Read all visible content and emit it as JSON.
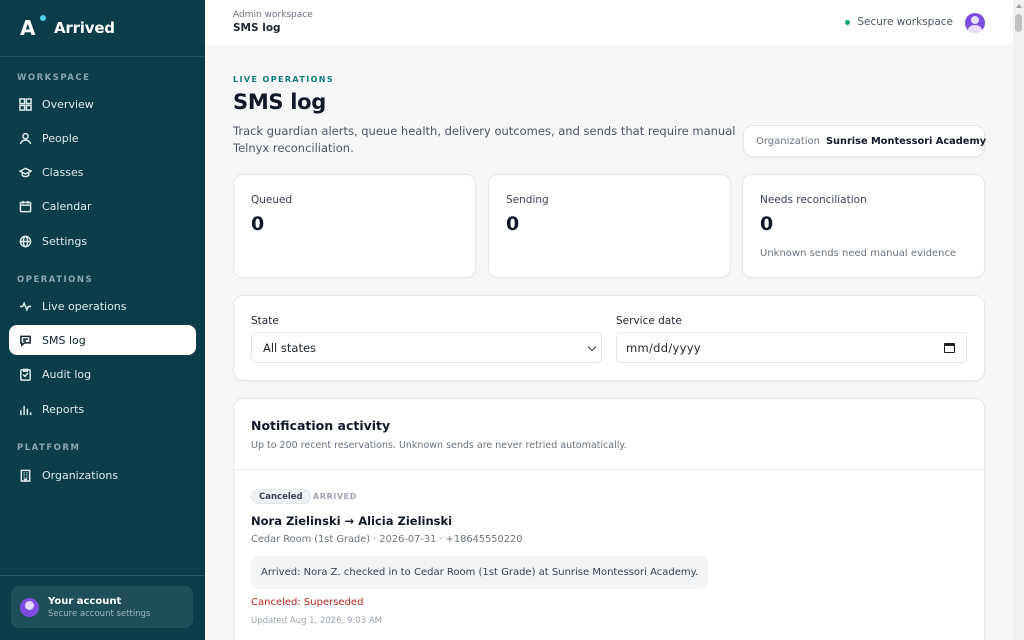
{
  "brand": {
    "name": "Arrived"
  },
  "sidebar": {
    "sections": {
      "workspace": "WORKSPACE",
      "operations": "OPERATIONS",
      "platform": "PLATFORM"
    },
    "items": [
      {
        "label": "Overview",
        "icon": "grid-icon"
      },
      {
        "label": "People",
        "icon": "person-icon"
      },
      {
        "label": "Classes",
        "icon": "graduation-cap-icon"
      },
      {
        "label": "Calendar",
        "icon": "calendar-icon"
      },
      {
        "label": "Settings",
        "icon": "globe-gear-icon"
      },
      {
        "label": "Live operations",
        "icon": "activity-icon"
      },
      {
        "label": "SMS log",
        "icon": "message-icon",
        "active": true
      },
      {
        "label": "Audit log",
        "icon": "clipboard-icon"
      },
      {
        "label": "Reports",
        "icon": "bar-chart-icon"
      },
      {
        "label": "Organizations",
        "icon": "building-icon"
      }
    ],
    "account": {
      "title": "Your account",
      "subtitle": "Secure account settings"
    }
  },
  "topbar": {
    "breadcrumb_small": "Admin workspace",
    "breadcrumb_main": "SMS log",
    "status": "Secure workspace",
    "status_color": "#10a56b"
  },
  "page": {
    "eyebrow": "LIVE OPERATIONS",
    "title": "SMS log",
    "description": "Track guardian alerts, queue health, delivery outcomes, and sends that require manual Telnyx reconciliation.",
    "org_label": "Organization",
    "org_value": "Sunrise Montessori Academy"
  },
  "stats": [
    {
      "label": "Queued",
      "value": "0",
      "note": ""
    },
    {
      "label": "Sending",
      "value": "0",
      "note": ""
    },
    {
      "label": "Needs reconciliation",
      "value": "0",
      "note": "Unknown sends need manual evidence"
    }
  ],
  "filters": {
    "state_label": "State",
    "state_value": "All states",
    "date_label": "Service date",
    "date_placeholder": "mm/dd/yyyy"
  },
  "activity": {
    "title": "Notification activity",
    "subtitle": "Up to 200 recent reservations. Unknown sends are never retried automatically.",
    "items": [
      {
        "badge": "Canceled",
        "state": "ARRIVED",
        "route": "Nora Zielinski → Alicia Zielinski",
        "meta": "Cedar Room (1st Grade) · 2026-07-31 · +18645550220",
        "message": "Arrived: Nora Z. checked in to Cedar Room (1st Grade) at Sunrise Montessori Academy.",
        "status": "Canceled: Superseded",
        "status_color": "#b42318",
        "updated": "Updated Aug 1, 2026, 9:03 AM"
      }
    ]
  },
  "colors": {
    "sidebar_bg": "#0b3c4a",
    "accent": "#0e7a7a",
    "avatar": "#7c4dde"
  }
}
